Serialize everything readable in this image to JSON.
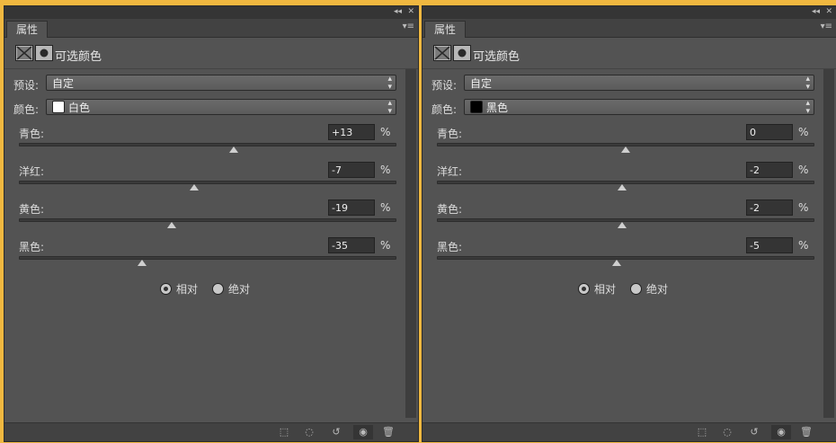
{
  "panels": [
    {
      "tab": "属性",
      "title": "可选颜色",
      "preset_label": "预设:",
      "preset_value": "自定",
      "color_label": "颜色:",
      "color_value": "白色",
      "color_swatch": "#ffffff",
      "sliders": [
        {
          "label": "青色:",
          "value": "+13",
          "unit": "%",
          "position": 0.57
        },
        {
          "label": "洋红:",
          "value": "-7",
          "unit": "%",
          "position": 0.465
        },
        {
          "label": "黄色:",
          "value": "-19",
          "unit": "%",
          "position": 0.405
        },
        {
          "label": "黑色:",
          "value": "-35",
          "unit": "%",
          "position": 0.325
        }
      ],
      "radios": [
        {
          "label": "相对",
          "checked": true
        },
        {
          "label": "绝对",
          "checked": false
        }
      ]
    },
    {
      "tab": "属性",
      "title": "可选颜色",
      "preset_label": "预设:",
      "preset_value": "自定",
      "color_label": "颜色:",
      "color_value": "黑色",
      "color_swatch": "#000000",
      "sliders": [
        {
          "label": "青色:",
          "value": "0",
          "unit": "%",
          "position": 0.5
        },
        {
          "label": "洋红:",
          "value": "-2",
          "unit": "%",
          "position": 0.49
        },
        {
          "label": "黄色:",
          "value": "-2",
          "unit": "%",
          "position": 0.49
        },
        {
          "label": "黑色:",
          "value": "-5",
          "unit": "%",
          "position": 0.475
        }
      ],
      "radios": [
        {
          "label": "相对",
          "checked": true
        },
        {
          "label": "绝对",
          "checked": false
        }
      ]
    }
  ],
  "colors": {
    "panel_bg": "#535353",
    "highlight_border": "#f0b840"
  },
  "footer_icons": [
    "clip-to-layer-icon",
    "view-previous-icon",
    "reset-icon",
    "visibility-eye-icon",
    "trash-icon"
  ]
}
